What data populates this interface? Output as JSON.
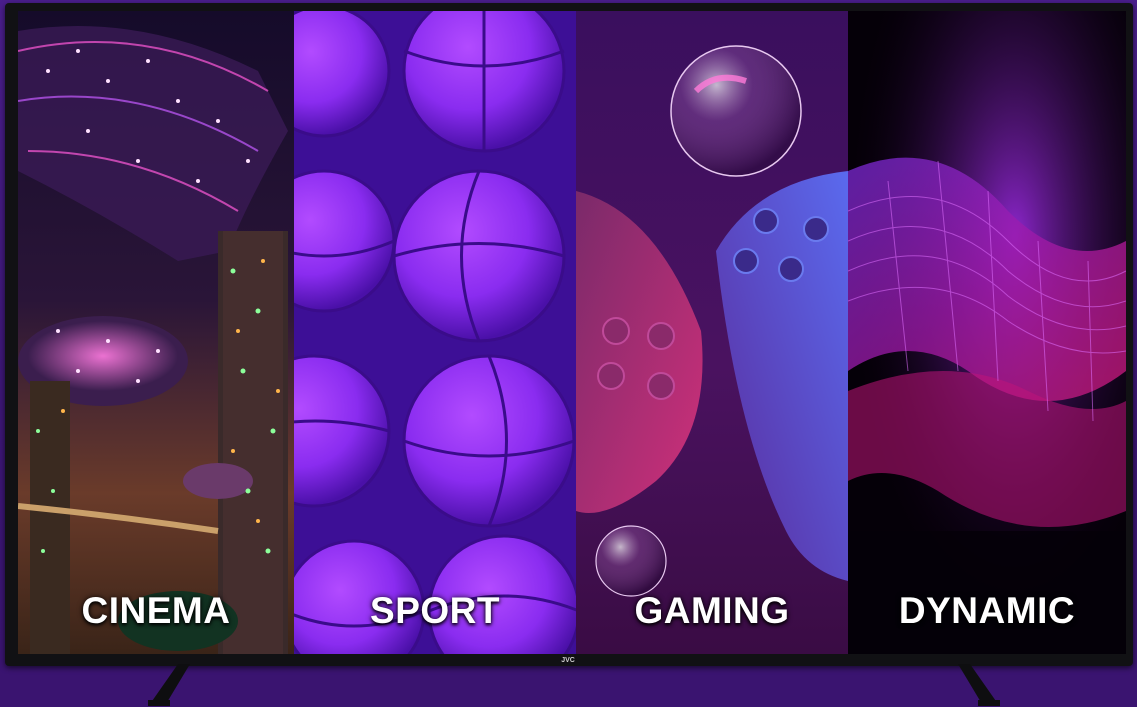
{
  "tv": {
    "brand": "JVC"
  },
  "modes": [
    {
      "label": "CINEMA"
    },
    {
      "label": "SPORT"
    },
    {
      "label": "GAMING"
    },
    {
      "label": "DYNAMIC"
    }
  ],
  "colors": {
    "background": "#3c1675",
    "bezel": "#111114",
    "label_text": "#ffffff",
    "accent_purple": "#7a2cff",
    "accent_magenta": "#d0208a"
  }
}
